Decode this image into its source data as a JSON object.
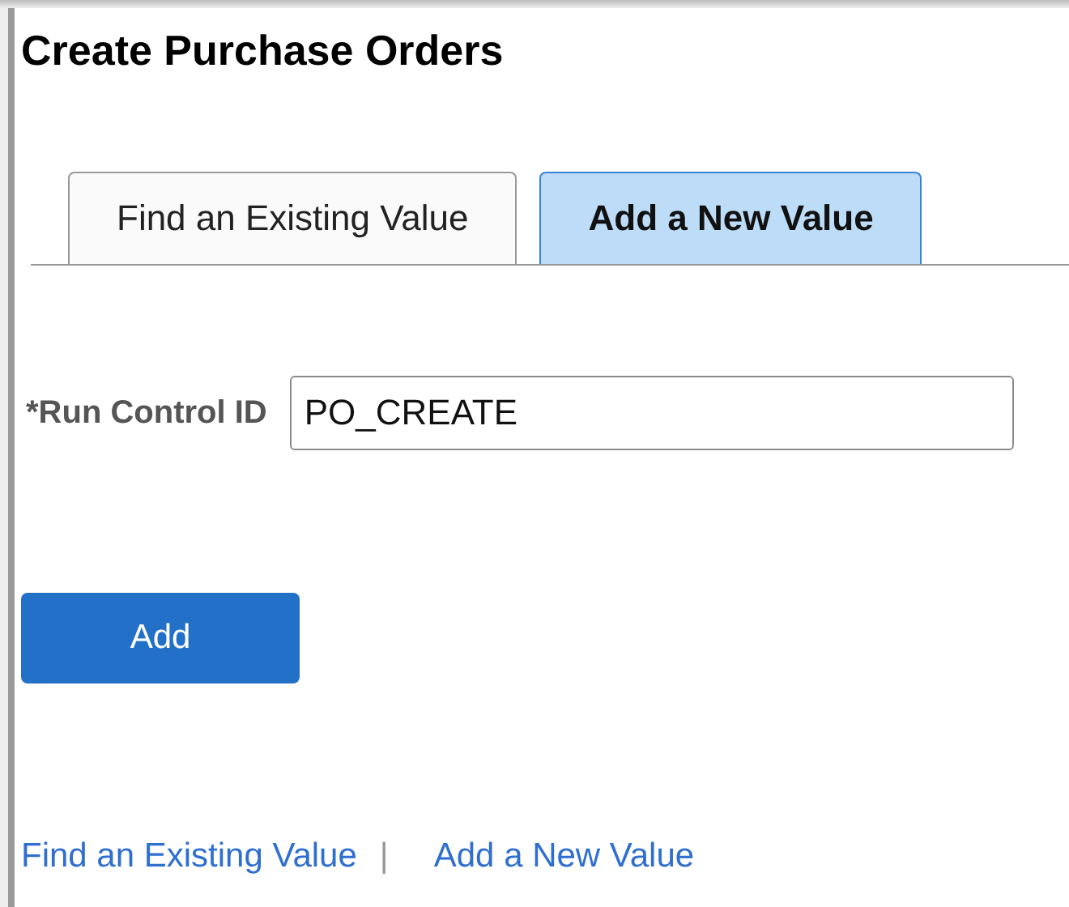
{
  "page": {
    "title": "Create Purchase Orders"
  },
  "tabs": [
    {
      "label": "Find an Existing Value",
      "selected": false
    },
    {
      "label": "Add a New Value",
      "selected": true
    }
  ],
  "run_control_id": {
    "label": "*Run Control ID",
    "value": "PO_CREATE"
  },
  "add_button": "Add",
  "footer_links": [
    {
      "label": "Find an Existing Value"
    },
    {
      "label": "Add a New Value"
    }
  ],
  "footer_separator": "|"
}
